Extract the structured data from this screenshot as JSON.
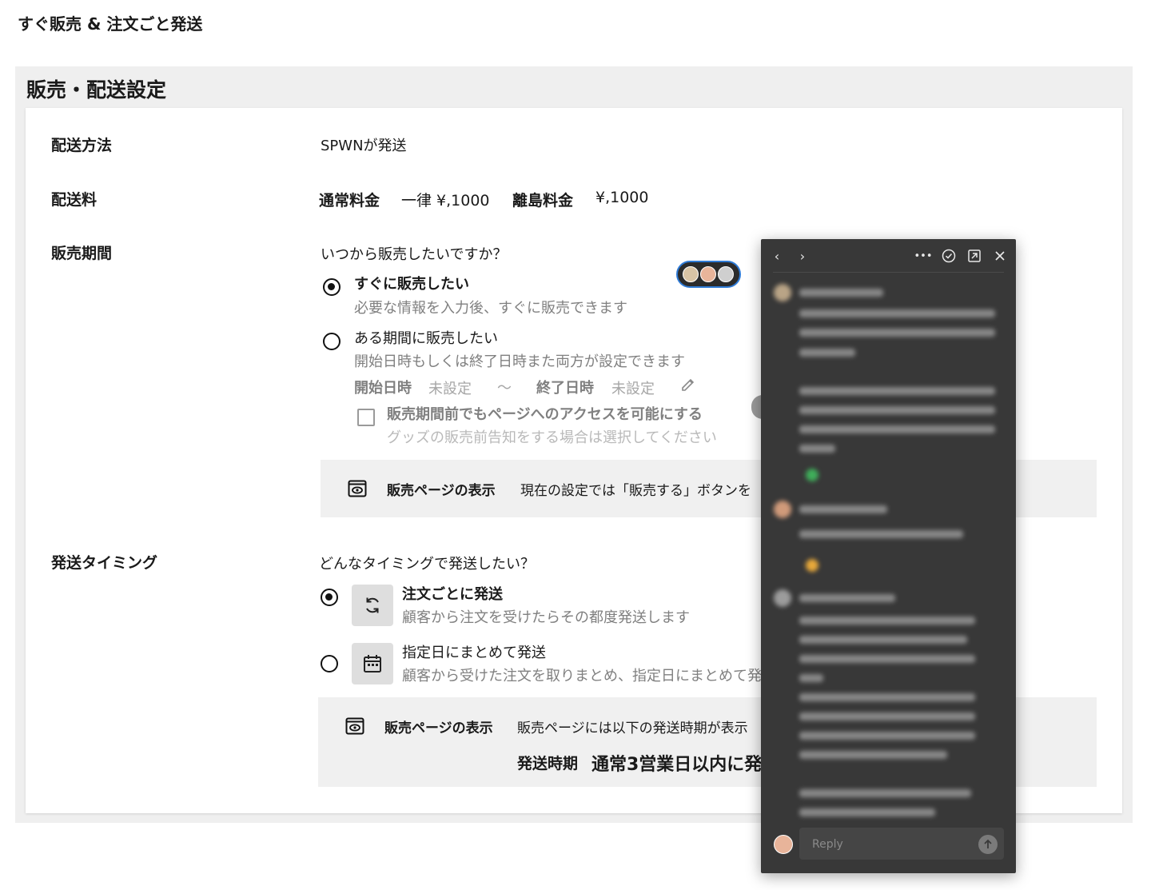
{
  "page": {
    "title": "すぐ販売 & 注文ごと発送"
  },
  "section": {
    "title": "販売・配送設定"
  },
  "shipping_method": {
    "label": "配送方法",
    "value": "SPWNが発送"
  },
  "shipping_fee": {
    "label": "配送料",
    "normal_label": "通常料金",
    "normal_value": "一律 ¥,1000",
    "island_label": "離島料金",
    "island_value": "¥,1000"
  },
  "sales_period": {
    "label": "販売期間",
    "question": "いつから販売したいですか？",
    "option_now": {
      "title": "すぐに販売したい",
      "desc": "必要な情報を入力後、すぐに販売できます",
      "selected": true
    },
    "option_period": {
      "title": "ある期間に販売したい",
      "desc": "開始日時もしくは終了日時また両方が設定できます",
      "selected": false
    },
    "start_label": "開始日時",
    "start_value": "未設定",
    "separator": "〜",
    "end_label": "終了日時",
    "end_value": "未設定",
    "pre_access": {
      "label": "販売期間前でもページへのアクセスを可能にする",
      "hint": "グッズの販売前告知をする場合は選択してください",
      "checked": false
    },
    "display_box": {
      "title": "販売ページの表示",
      "text": "現在の設定では「販売する」ボタンを"
    }
  },
  "shipping_timing": {
    "label": "発送タイミング",
    "question": "どんなタイミングで発送したい？",
    "option_per_order": {
      "title": "注文ごとに発送",
      "desc": "顧客から注文を受けたらその都度発送します",
      "selected": true,
      "icon": "sync-icon"
    },
    "option_scheduled": {
      "title": "指定日にまとめて発送",
      "desc": "顧客から受けた注文を取りまとめ、指定日にまとめて発",
      "selected": false,
      "icon": "calendar-icon"
    },
    "display_box": {
      "title": "販売ページの表示",
      "text": "販売ページには以下の発送時期が表示",
      "period_label": "発送時期",
      "period_value": "通常3営業日以内に発"
    }
  },
  "comment_panel": {
    "reply_placeholder": "Reply",
    "icons": [
      "chevron-left-icon",
      "chevron-right-icon",
      "more-icon",
      "resolve-check-icon",
      "popout-icon",
      "close-icon"
    ]
  },
  "colors": {
    "accent": "#2f7bd6",
    "panel_bg": "#383838",
    "box_bg": "#f0f0f0"
  }
}
